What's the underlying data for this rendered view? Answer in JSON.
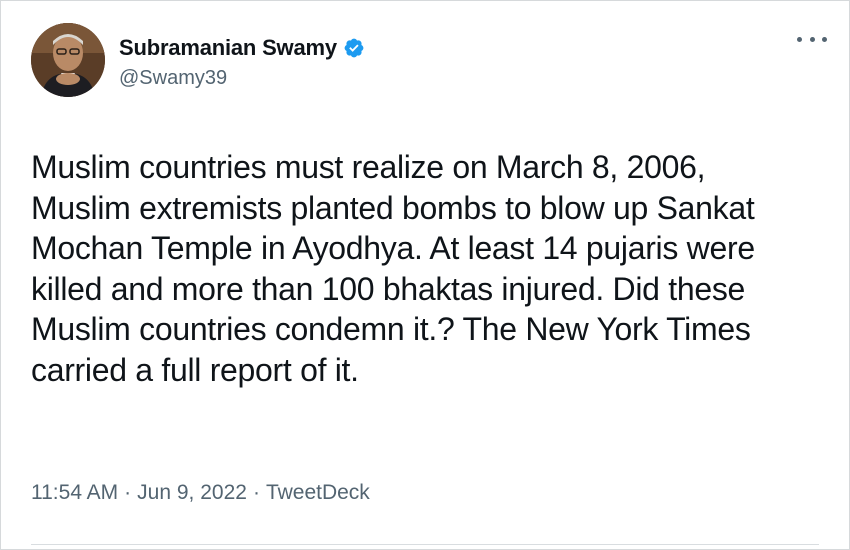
{
  "user": {
    "display_name": "Subramanian Swamy",
    "handle": "@Swamy39",
    "verified": true
  },
  "tweet": {
    "lines": [
      "Muslim countries must realize on March 8, 2006,",
      "Muslim extremists planted bombs to blow up Sankat",
      "Mochan Temple in Ayodhya. At least 14 pujaris were",
      "killed and more than 100 bhaktas injured. Did these",
      "Muslim countries condemn it.? The New York Times",
      "carried a full report of it."
    ],
    "time": "11:54 AM",
    "separator": "·",
    "date": "Jun 9, 2022",
    "source": "TweetDeck"
  },
  "icons": {
    "verified": "verified-badge-icon",
    "more": "more-options-icon"
  },
  "colors": {
    "verified_blue": "#1d9bf0",
    "text": "#0f1419",
    "secondary_text": "#536471"
  }
}
